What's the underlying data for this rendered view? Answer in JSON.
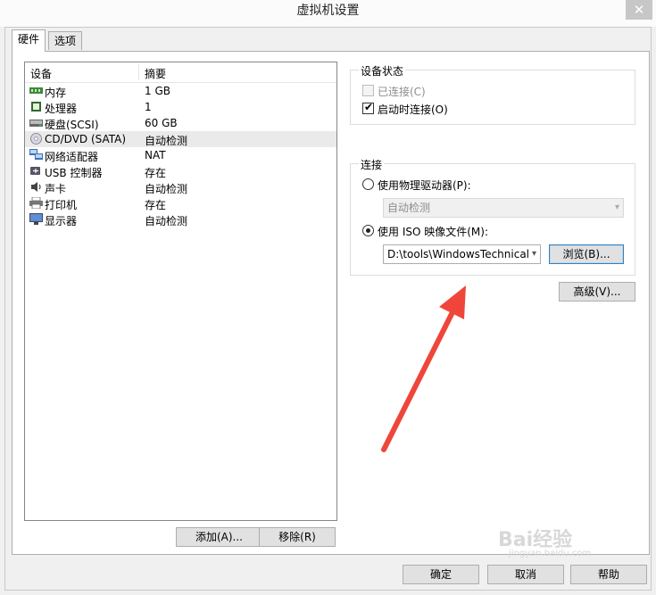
{
  "window": {
    "title": "虚拟机设置",
    "close_glyph": "✕"
  },
  "tabs": [
    {
      "label": "硬件"
    },
    {
      "label": "选项"
    }
  ],
  "device_list": {
    "columns": [
      "设备",
      "摘要"
    ],
    "rows": [
      {
        "name": "内存",
        "summary": "1 GB",
        "icon": "memory-icon"
      },
      {
        "name": "处理器",
        "summary": "1",
        "icon": "processor-icon"
      },
      {
        "name": "硬盘(SCSI)",
        "summary": "60 GB",
        "icon": "hard-disk-icon"
      },
      {
        "name": "CD/DVD (SATA)",
        "summary": "自动检测",
        "icon": "cd-dvd-icon",
        "selected": true
      },
      {
        "name": "网络适配器",
        "summary": "NAT",
        "icon": "network-adapter-icon"
      },
      {
        "name": "USB 控制器",
        "summary": "存在",
        "icon": "usb-icon"
      },
      {
        "name": "声卡",
        "summary": "自动检测",
        "icon": "sound-card-icon"
      },
      {
        "name": "打印机",
        "summary": "存在",
        "icon": "printer-icon"
      },
      {
        "name": "显示器",
        "summary": "自动检测",
        "icon": "display-icon"
      }
    ]
  },
  "list_buttons": {
    "add": "添加(A)...",
    "remove": "移除(R)"
  },
  "device_status": {
    "title": "设备状态",
    "connected": {
      "label": "已连接(C)",
      "checked": false,
      "disabled": true
    },
    "connect_at_power_on": {
      "label": "启动时连接(O)",
      "checked": true
    }
  },
  "connection": {
    "title": "连接",
    "physical_drive": {
      "label": "使用物理驱动器(P):",
      "selected": false,
      "value": "自动检测"
    },
    "iso_image": {
      "label": "使用 ISO 映像文件(M):",
      "selected": true,
      "value": "D:\\tools\\WindowsTechnicalP"
    },
    "browse_label": "浏览(B)..."
  },
  "advanced_label": "高级(V)...",
  "footer": {
    "ok": "确定",
    "cancel": "取消",
    "help": "帮助"
  },
  "watermark": {
    "brand": "Bai经验",
    "url": "jingyan.baidu.com"
  },
  "colors": {
    "arrow": "#f0453a",
    "selection": "#eaeaea",
    "focus_border": "#3c7fb1"
  }
}
